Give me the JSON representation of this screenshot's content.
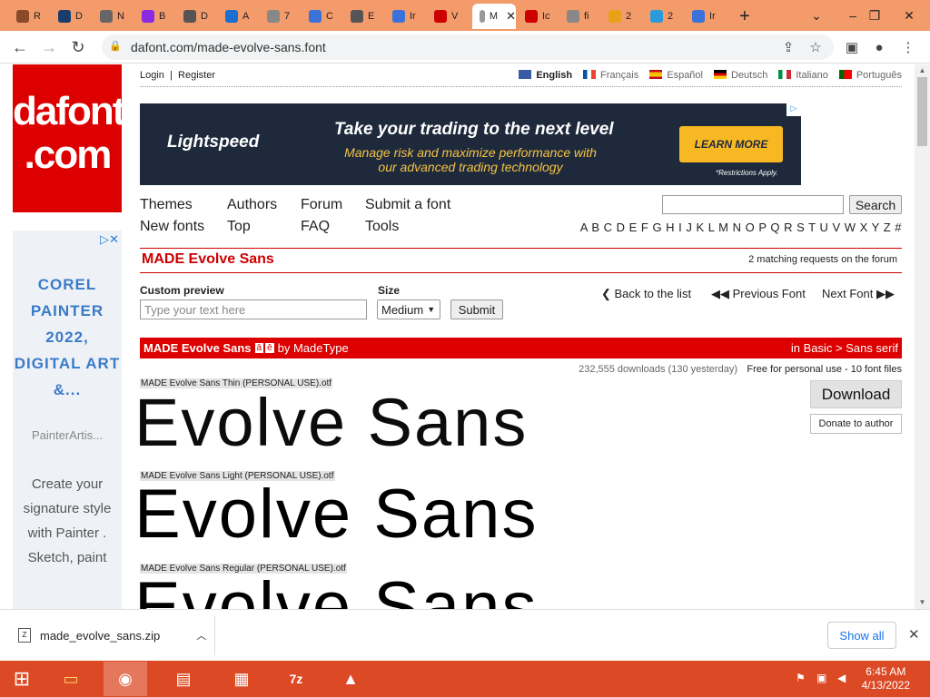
{
  "browser": {
    "tabs": [
      {
        "letter": "R",
        "color": "#8a4b2a"
      },
      {
        "letter": "D",
        "color": "#1a3d6b"
      },
      {
        "letter": "N",
        "color": "#666"
      },
      {
        "letter": "B",
        "color": "#8a2be2"
      },
      {
        "letter": "D",
        "color": "#555"
      },
      {
        "letter": "A",
        "color": "#1a6fd1"
      },
      {
        "letter": "7",
        "color": "#888"
      },
      {
        "letter": "C",
        "color": "#3b72d9"
      },
      {
        "letter": "E",
        "color": "#555"
      },
      {
        "letter": "Ir",
        "color": "#3b72d9"
      },
      {
        "letter": "V",
        "color": "#c00"
      },
      {
        "letter": "M",
        "color": "#999"
      },
      {
        "letter": "Ic",
        "color": "#c00"
      },
      {
        "letter": "fi",
        "color": "#888"
      },
      {
        "letter": "2",
        "color": "#e8a21a"
      },
      {
        "letter": "2",
        "color": "#2a9adc"
      },
      {
        "letter": "Ir",
        "color": "#3b72d9"
      }
    ],
    "url": "dafont.com/made-evolve-sans.font"
  },
  "site": {
    "logo": "dafont\n.com",
    "login": "Login",
    "register": "Register",
    "languages": [
      "English",
      "Français",
      "Español",
      "Deutsch",
      "Italiano",
      "Português"
    ],
    "banner": {
      "logo": "Lightspeed",
      "headline": "Take your trading to the next level",
      "subline": "Manage risk and maximize performance with our advanced trading technology",
      "cta": "LEARN MORE",
      "fine": "*Restrictions Apply."
    },
    "menu": [
      "Themes",
      "Authors",
      "Forum",
      "Submit a font",
      "New fonts",
      "Top",
      "FAQ",
      "Tools"
    ],
    "search_btn": "Search",
    "alphabet": "A B C D E F G H I J K L M N O P Q R S T U V W X Y Z #",
    "sidead": {
      "brand": "COREL PAINTER 2022, DIGITAL ART &...",
      "url": "PainterArtis...",
      "desc": "Create your signature style with Painter . Sketch, paint"
    }
  },
  "font": {
    "title": "MADE Evolve Sans",
    "forum": "2 matching requests on the forum",
    "custom_preview_label": "Custom preview",
    "size_label": "Size",
    "preview_placeholder": "Type your text here",
    "size_value": "Medium",
    "submit": "Submit",
    "back": "Back to the list",
    "previous": "Previous Font",
    "next": "Next Font",
    "bar_title": "MADE Evolve Sans",
    "bar_by": "by MadeType",
    "category": "in Basic > Sans serif",
    "downloads": "232,555 downloads (130 yesterday)",
    "license": "Free for personal use - 10 font files",
    "download_btn": "Download",
    "donate_btn": "Donate to author",
    "files": [
      {
        "name": "MADE Evolve Sans Thin (PERSONAL USE).otf",
        "sample": "Evolve Sans"
      },
      {
        "name": "MADE Evolve Sans Light (PERSONAL USE).otf",
        "sample": "Evolve Sans"
      },
      {
        "name": "MADE Evolve Sans Regular (PERSONAL USE).otf",
        "sample": "Evolve Sans"
      }
    ]
  },
  "downloads": {
    "file": "made_evolve_sans.zip",
    "show_all": "Show all"
  },
  "taskbar": {
    "time": "6:45 AM",
    "date": "4/13/2022"
  }
}
